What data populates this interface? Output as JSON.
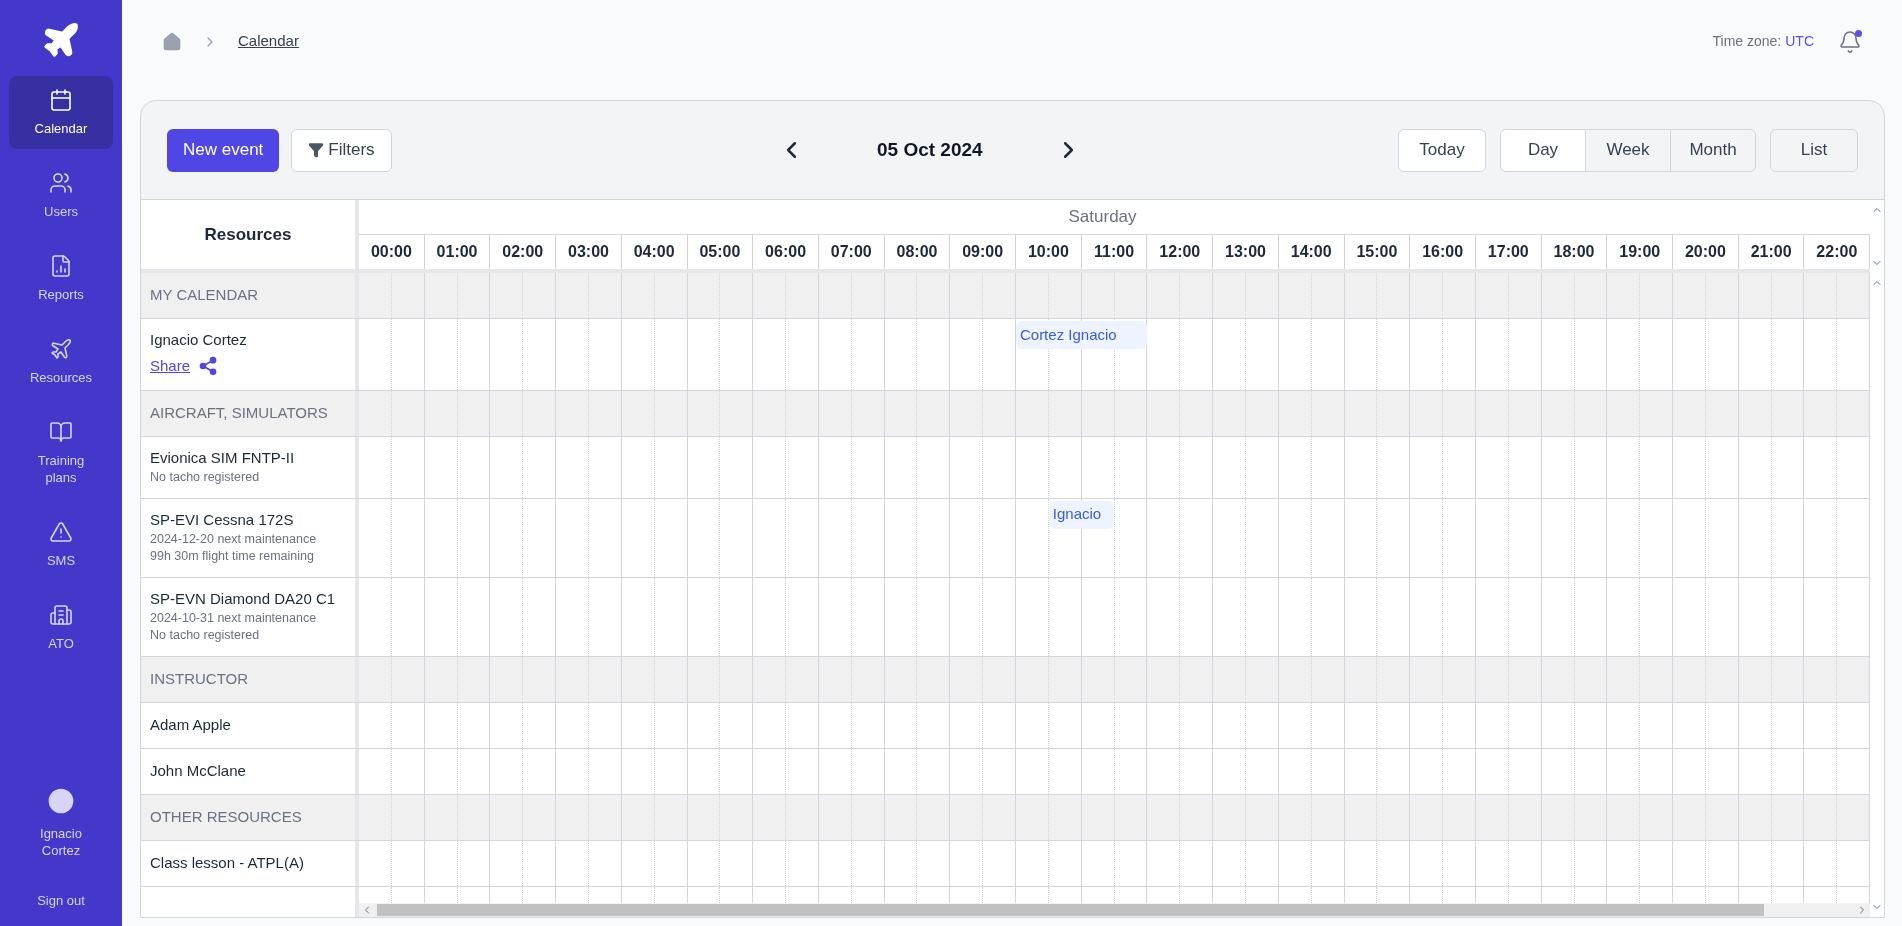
{
  "breadcrumb": {
    "current": "Calendar"
  },
  "header": {
    "timezone_label": "Time zone:",
    "timezone_value": "UTC",
    "notification_dot": true
  },
  "sidebar": {
    "items": [
      {
        "label": "Calendar",
        "selected": true
      },
      {
        "label": "Users",
        "selected": false
      },
      {
        "label": "Reports",
        "selected": false
      },
      {
        "label": "Resources",
        "selected": false
      },
      {
        "label": "Training plans",
        "selected": false
      },
      {
        "label": "SMS",
        "selected": false
      },
      {
        "label": "ATO",
        "selected": false
      }
    ],
    "user": {
      "name": "Ignacio Cortez"
    },
    "sign_out": "Sign out"
  },
  "toolbar": {
    "new_event": "New event",
    "filters": "Filters",
    "date": "05 Oct 2024",
    "today": "Today",
    "views": [
      {
        "label": "Day",
        "selected": true
      },
      {
        "label": "Week",
        "selected": false
      },
      {
        "label": "Month",
        "selected": false
      }
    ],
    "list": "List"
  },
  "calendar": {
    "resources_heading": "Resources",
    "day": "Saturday",
    "hours": [
      "00:00",
      "01:00",
      "02:00",
      "03:00",
      "04:00",
      "05:00",
      "06:00",
      "07:00",
      "08:00",
      "09:00",
      "10:00",
      "11:00",
      "12:00",
      "13:00",
      "14:00",
      "15:00",
      "16:00",
      "17:00",
      "18:00",
      "19:00",
      "20:00",
      "21:00",
      "22:00"
    ],
    "rows": [
      {
        "kind": "group",
        "label": "MY CALENDAR"
      },
      {
        "kind": "resource",
        "name": "Ignacio Cortez",
        "link": "Share",
        "details": [],
        "events": [
          {
            "label": "Cortez Ignacio"
          }
        ]
      },
      {
        "kind": "group",
        "label": "AIRCRAFT, SIMULATORS"
      },
      {
        "kind": "resource",
        "name": "Evionica SIM FNTP-II",
        "details": [
          "No tacho registered"
        ],
        "events": []
      },
      {
        "kind": "resource",
        "name": "SP-EVI Cessna 172S",
        "details": [
          "2024-12-20 next maintenance",
          "99h 30m flight time remaining"
        ],
        "events": [
          {
            "label": "Ignacio"
          }
        ]
      },
      {
        "kind": "resource",
        "name": "SP-EVN Diamond DA20 C1",
        "details": [
          "2024-10-31 next maintenance",
          "No tacho registered"
        ],
        "events": []
      },
      {
        "kind": "group",
        "label": "INSTRUCTOR"
      },
      {
        "kind": "resource",
        "name": "Adam Apple",
        "details": [],
        "events": []
      },
      {
        "kind": "resource",
        "name": "John McClane",
        "details": [],
        "events": []
      },
      {
        "kind": "group",
        "label": "OTHER RESOURCES"
      },
      {
        "kind": "resource",
        "name": "Class lesson - ATPL(A)",
        "details": [],
        "events": []
      }
    ]
  }
}
